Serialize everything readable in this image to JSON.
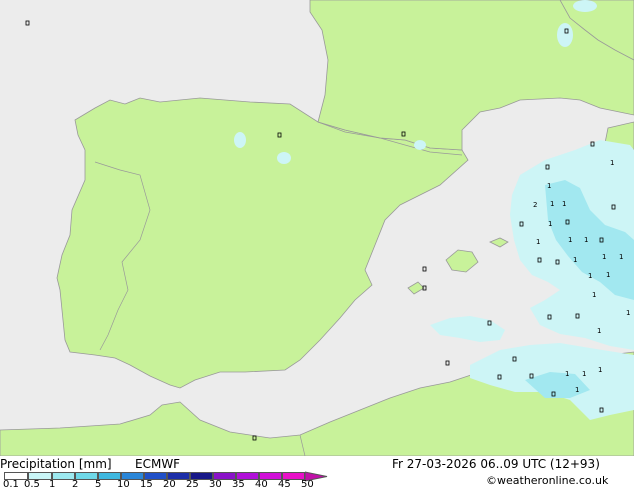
{
  "footer": {
    "title": "Precipitation [mm]",
    "model": "ECMWF",
    "datetime": "Fr 27-03-2026 06..09 UTC (12+93)",
    "copyright": "©weatheronline.co.uk"
  },
  "colorbar": {
    "labels": [
      "0.1",
      "0.5",
      "1",
      "2",
      "5",
      "10",
      "15",
      "20",
      "25",
      "30",
      "35",
      "40",
      "45",
      "50"
    ],
    "colors": [
      "#ffffff",
      "#c9f5f7",
      "#9de9f0",
      "#6fd8e8",
      "#3fb8e0",
      "#2a86d8",
      "#2050c8",
      "#1c2ea8",
      "#181888",
      "#8a12c8",
      "#b010d8",
      "#d010d8",
      "#e810c8",
      "#c010a8"
    ]
  },
  "colors": {
    "sea": "#ececec",
    "land": "#c8f29a",
    "border": "#999999",
    "precip_light": "#cdf5f6",
    "precip_medium": "#a2e8f0"
  },
  "map_labels": [
    "1",
    "1",
    "2",
    "1",
    "1",
    "1",
    "1",
    "1",
    "1",
    "1",
    "1",
    "1",
    "1",
    "1",
    "1",
    "1",
    "1",
    "1",
    "1",
    "1",
    "1"
  ]
}
